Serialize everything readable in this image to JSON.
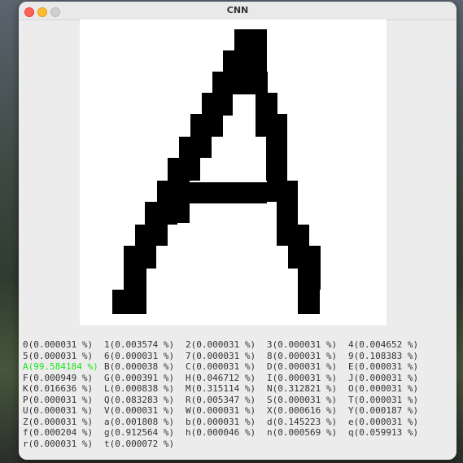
{
  "window": {
    "title": "CNN"
  },
  "drawing": {
    "letter": "A",
    "stroke_color": "#000000",
    "background_color": "#ffffff"
  },
  "predictions": [
    "0(0.000031 %)",
    "1(0.003574 %)",
    "2(0.000031 %)",
    "3(0.000031 %)",
    "4(0.004652 %)",
    "5(0.000031 %)",
    "6(0.000031 %)",
    "7(0.000031 %)",
    "8(0.000031 %)",
    "9(0.108383 %)",
    "A(99.584184 %)",
    "B(0.000038 %)",
    "C(0.000031 %)",
    "D(0.000031 %)",
    "E(0.000031 %)",
    "F(0.000949 %)",
    "G(0.000391 %)",
    "H(0.046712 %)",
    "I(0.000031 %)",
    "J(0.000031 %)",
    "K(0.016636 %)",
    "L(0.000838 %)",
    "M(0.315114 %)",
    "N(0.312821 %)",
    "O(0.000031 %)",
    "P(0.000031 %)",
    "Q(0.083283 %)",
    "R(0.005347 %)",
    "S(0.000031 %)",
    "T(0.000031 %)",
    "U(0.000031 %)",
    "V(0.000031 %)",
    "W(0.000031 %)",
    "X(0.000616 %)",
    "Y(0.000187 %)",
    "Z(0.000031 %)",
    "a(0.001808 %)",
    "b(0.000031 %)",
    "d(0.145223 %)",
    "e(0.000031 %)",
    "f(0.000204 %)",
    "g(0.912564 %)",
    "h(0.000046 %)",
    "n(0.000569 %)",
    "q(0.059913 %)",
    "r(0.000031 %)",
    "t(0.000072 %)"
  ],
  "top_prediction_index": 10,
  "colors": {
    "top_prediction": "#19e619",
    "prediction_text": "#333333"
  }
}
